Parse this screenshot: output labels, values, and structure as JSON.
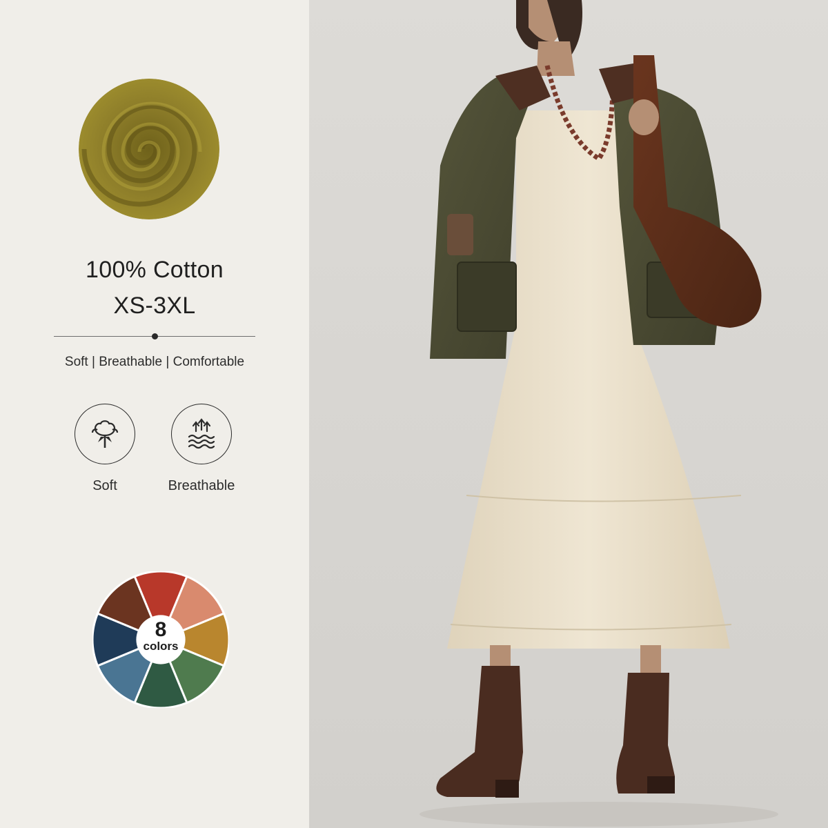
{
  "info": {
    "material": "100% Cotton",
    "sizes": "XS-3XL",
    "tagline": "Soft | Breathable | Comfortable",
    "features": [
      {
        "label": "Soft",
        "icon": "cotton-flower-icon"
      },
      {
        "label": "Breathable",
        "icon": "airflow-waves-icon"
      }
    ],
    "color_count": "8",
    "color_unit": "colors"
  },
  "swatch_colors": [
    "#b8382a",
    "#d98a6e",
    "#b9862e",
    "#4f7b4e",
    "#2f5a43",
    "#4a7593",
    "#1f3b58",
    "#6b3420"
  ],
  "fabric_color": "#8a7a26",
  "accent_colors": {
    "jacket": "#4a4a33",
    "dress": "#ebe1cc",
    "bag": "#5a2d1a",
    "boots": "#4a2c20"
  }
}
